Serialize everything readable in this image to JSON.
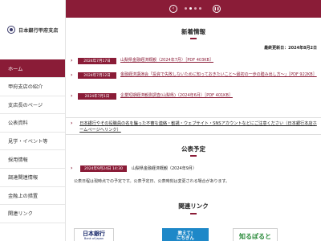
{
  "sidebar": {
    "logo_text": "日本銀行甲府支店",
    "items": [
      {
        "label": "ホーム",
        "active": true
      },
      {
        "label": "甲府支店の紹介",
        "active": false
      },
      {
        "label": "支店長のページ",
        "active": false
      },
      {
        "label": "公表資料",
        "active": false
      },
      {
        "label": "見学・イベント等",
        "active": false
      },
      {
        "label": "採用情報",
        "active": false
      },
      {
        "label": "調達関連情報",
        "active": false
      },
      {
        "label": "金融上の措置",
        "active": false
      },
      {
        "label": "関連リンク",
        "active": false
      }
    ]
  },
  "slider": {
    "prev_icon": "‹",
    "pause_icon": "❚❚",
    "dots": [
      false,
      true,
      false,
      false
    ]
  },
  "news": {
    "title": "新着情報",
    "updated_label": "最終更新日：",
    "updated_value": "2024年8月2日",
    "items": [
      {
        "date": "2024年7月17日",
        "text": "山梨県金融経済概観（2024年7月）［PDF 403KB］"
      },
      {
        "date": "2024年7月12日",
        "text": "金融経済講演会「投資で失敗しないために知っておきたいこと〜最初の一歩の踏み出し方〜」［PDF 922KB］"
      },
      {
        "date": "2024年7月1日",
        "text": "企業短期経済観測調査(山梨県)（2024年6月）［PDF 401KB］"
      }
    ]
  },
  "notice": {
    "text": "日本銀行やその役職員の名を騙った不審な連絡・勧誘・ウェブサイト・SNSアカウントなどにご注意ください（日本銀行本店ホームページへリンク）"
  },
  "schedule": {
    "title": "公表予定",
    "date": "2024年9月24日 14:30",
    "text": "山梨県金融経済概観（2024年9月）",
    "note": "公表日程は現時点での予定です。公表予定日、公表時刻は変更される場合があります。"
  },
  "links": {
    "title": "関連リンク",
    "boj_main": "日本銀行",
    "boj_sub": "Bank of Japan",
    "kids_line1": "教えて!",
    "kids_line2": "にちぎん",
    "shiru": "知るぽると"
  },
  "colors": {
    "accent": "#8a1c37"
  }
}
